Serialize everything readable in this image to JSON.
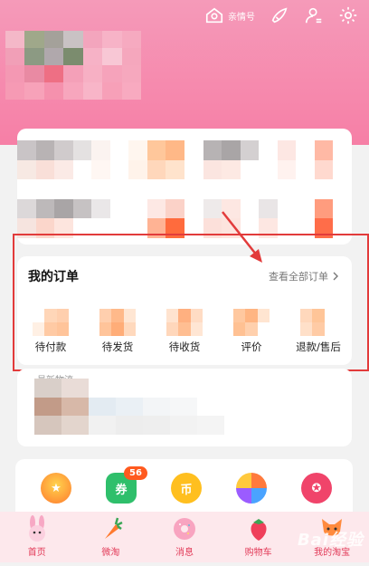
{
  "header": {
    "family_account_label": "亲情号",
    "icons": [
      "family-home-icon",
      "skin-brush-icon",
      "user-settings-icon",
      "gear-icon"
    ]
  },
  "orders": {
    "title": "我的订单",
    "view_all_label": "查看全部订单",
    "items": [
      {
        "label": "待付款",
        "icon": "pending-payment-icon"
      },
      {
        "label": "待发货",
        "icon": "pending-shipment-icon"
      },
      {
        "label": "待收货",
        "icon": "pending-receipt-icon"
      },
      {
        "label": "评价",
        "icon": "review-icon"
      },
      {
        "label": "退款/售后",
        "icon": "refund-icon"
      }
    ]
  },
  "logistics": {
    "title": "最新物流"
  },
  "services": {
    "badge_count": "56",
    "icons": [
      "trophy-icon",
      "coupon-chat-icon",
      "coin-icon",
      "game-icon",
      "medal-icon"
    ]
  },
  "tabbar": {
    "items": [
      {
        "label": "首页",
        "icon": "bunny-icon"
      },
      {
        "label": "微淘",
        "icon": "carrot-icon"
      },
      {
        "label": "消息",
        "icon": "donut-icon"
      },
      {
        "label": "购物车",
        "icon": "strawberry-icon"
      },
      {
        "label": "我的淘宝",
        "icon": "fox-icon"
      }
    ]
  },
  "watermark": "Bai经验",
  "colors": {
    "header_pink": "#f67fa6",
    "highlight_red": "#e23b3b",
    "tab_text": "#e23a58",
    "badge_orange": "#ff5a1f"
  }
}
